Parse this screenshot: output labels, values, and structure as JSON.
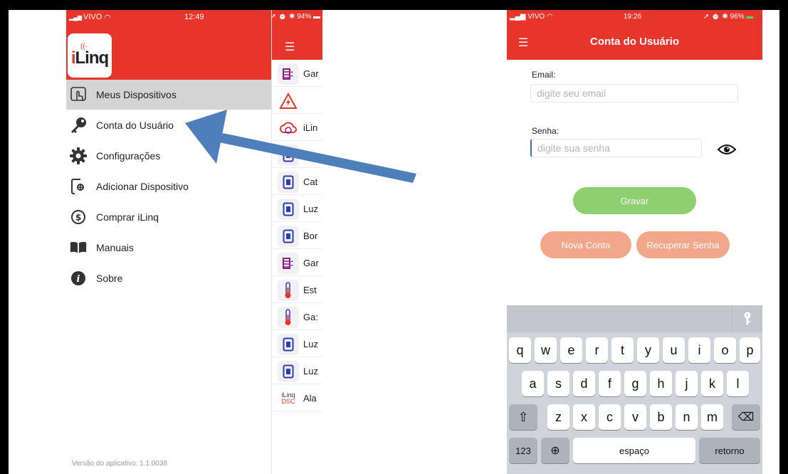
{
  "left_phone": {
    "status": {
      "carrier": "VIVO",
      "time": "12:49",
      "battery": "94%"
    },
    "logo_text_i": "i",
    "logo_text_rest": "Linq",
    "menu": [
      {
        "label": "Meus Dispositivos",
        "icon": "touch-hand-icon",
        "active": true
      },
      {
        "label": "Conta do Usuário",
        "icon": "key-icon",
        "active": false
      },
      {
        "label": "Configurações",
        "icon": "gear-icon",
        "active": false
      },
      {
        "label": "Adicionar Dispositivo",
        "icon": "add-device-icon",
        "active": false
      },
      {
        "label": "Comprar iLinq",
        "icon": "dollar-circle-icon",
        "active": false
      },
      {
        "label": "Manuais",
        "icon": "book-icon",
        "active": false
      },
      {
        "label": "Sobre",
        "icon": "info-icon",
        "active": false
      }
    ],
    "version": "Versão do aplicativo: 1.1.0038",
    "devices": [
      {
        "name": "Gar",
        "icon": "gate-icon"
      },
      {
        "name": "",
        "icon": "alert-triangle-icon"
      },
      {
        "name": "iLin",
        "icon": "cloud-device-icon"
      },
      {
        "name": "",
        "icon": "switch-icon"
      },
      {
        "name": "Cat",
        "icon": "switch-icon"
      },
      {
        "name": "Luz",
        "icon": "switch-icon"
      },
      {
        "name": "Bor",
        "icon": "switch-icon"
      },
      {
        "name": "Gar",
        "icon": "gate-icon"
      },
      {
        "name": "Est",
        "icon": "thermometer-icon"
      },
      {
        "name": "Ga:",
        "icon": "thermometer-icon"
      },
      {
        "name": "Luz",
        "icon": "switch-icon"
      },
      {
        "name": "Luz",
        "icon": "switch-icon"
      },
      {
        "name": "Ala",
        "icon": "ilinq-dsc-icon"
      }
    ]
  },
  "right_phone": {
    "status": {
      "carrier": "VIVO",
      "time": "19:26",
      "battery": "96%"
    },
    "title": "Conta do Usuário",
    "email_label": "Email:",
    "email_placeholder": "digite seu email",
    "password_label": "Senha:",
    "password_placeholder": "digite sua senha",
    "save_button": "Gravar",
    "new_account_button": "Nova Conta",
    "recover_button": "Recuperar Senha",
    "keyboard": {
      "row1": [
        "q",
        "w",
        "e",
        "r",
        "t",
        "y",
        "u",
        "i",
        "o",
        "p"
      ],
      "row2": [
        "a",
        "s",
        "d",
        "f",
        "g",
        "h",
        "j",
        "k",
        "l"
      ],
      "row3": [
        "z",
        "x",
        "c",
        "v",
        "b",
        "n",
        "m"
      ],
      "numbers_key": "123",
      "space_key": "espaço",
      "return_key": "retorno"
    }
  },
  "colors": {
    "brand_red": "#e8352b",
    "save_green": "#8ecf6f",
    "secondary_orange": "#f2a68a",
    "arrow_blue": "#4f7fba"
  }
}
